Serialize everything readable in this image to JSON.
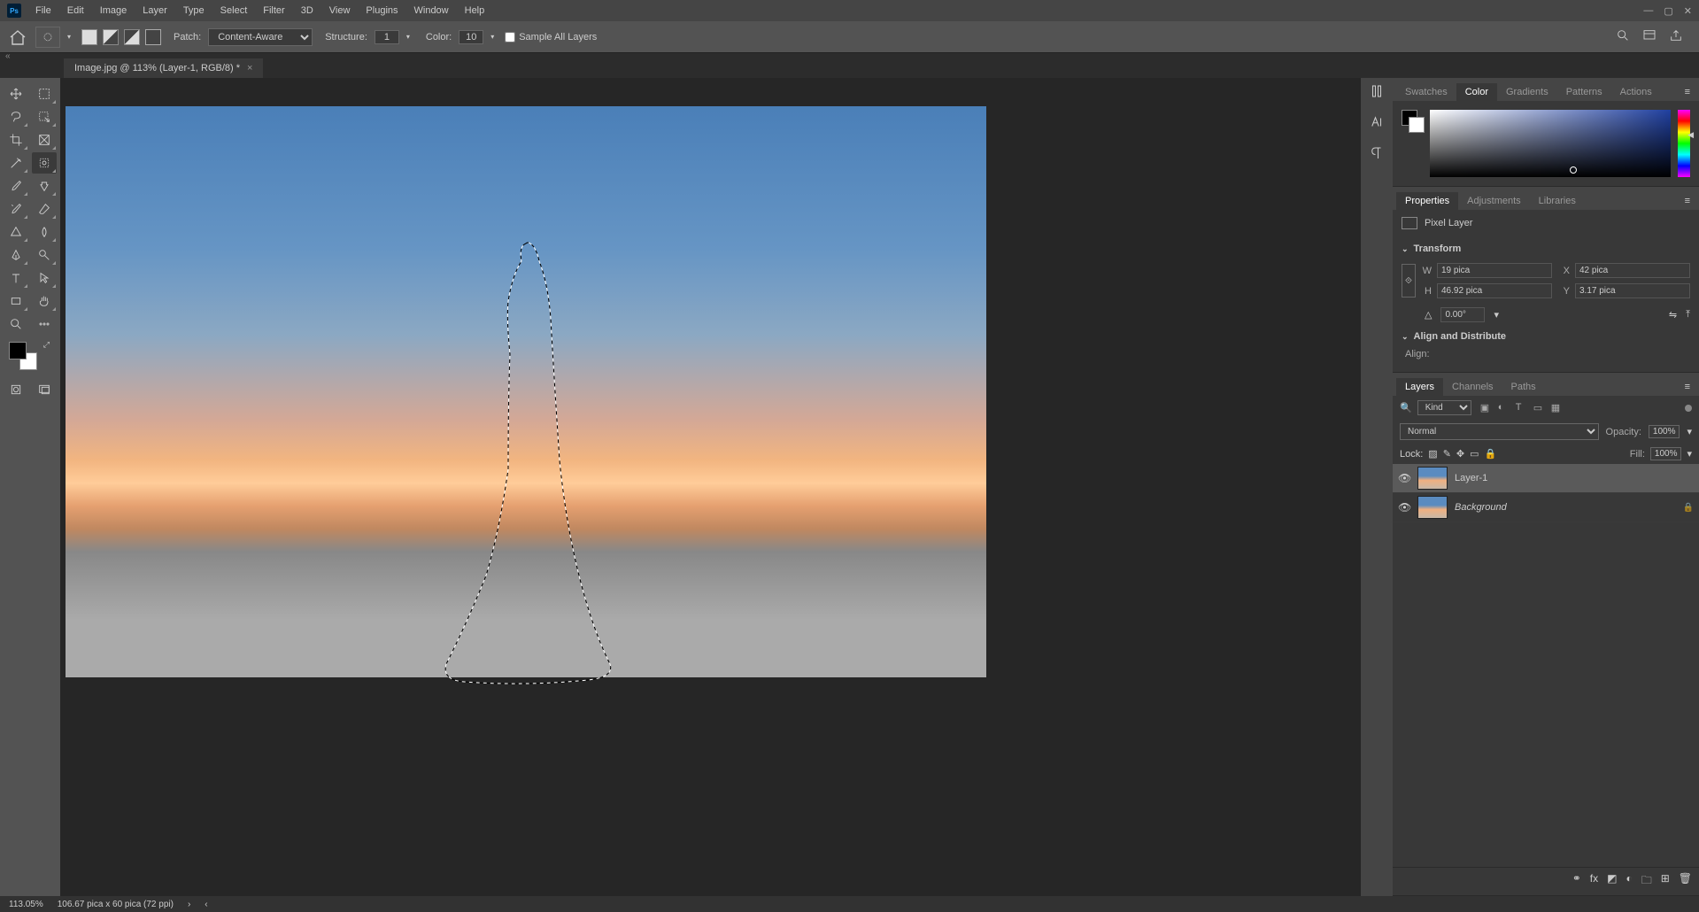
{
  "menu": [
    "File",
    "Edit",
    "Image",
    "Layer",
    "Type",
    "Select",
    "Filter",
    "3D",
    "View",
    "Plugins",
    "Window",
    "Help"
  ],
  "options": {
    "patch_label": "Patch:",
    "patch_mode": "Content-Aware",
    "structure_label": "Structure:",
    "structure_value": "1",
    "color_label": "Color:",
    "color_value": "10",
    "sample_all": "Sample All Layers"
  },
  "doc_tab": "Image.jpg @ 113% (Layer-1, RGB/8) *",
  "panels": {
    "color_tabs": [
      "Swatches",
      "Color",
      "Gradients",
      "Patterns",
      "Actions"
    ],
    "props_tabs": [
      "Properties",
      "Adjustments",
      "Libraries"
    ],
    "pixel_layer": "Pixel Layer",
    "transform": "Transform",
    "transform_vals": {
      "W": "19 pica",
      "H": "46.92 pica",
      "X": "42 pica",
      "Y": "3.17 pica",
      "angle": "0.00°"
    },
    "align_distribute": "Align and Distribute",
    "align_label": "Align:",
    "layers_tabs": [
      "Layers",
      "Channels",
      "Paths"
    ],
    "kind_label": "Kind",
    "blend_mode": "Normal",
    "opacity_label": "Opacity:",
    "opacity_value": "100%",
    "lock_label": "Lock:",
    "fill_label": "Fill:",
    "fill_value": "100%",
    "layers": [
      {
        "name": "Layer-1",
        "locked": false,
        "italic": false
      },
      {
        "name": "Background",
        "locked": true,
        "italic": true
      }
    ]
  },
  "status": {
    "zoom": "113.05%",
    "dims": "106.67 pica x 60 pica (72 ppi)"
  }
}
